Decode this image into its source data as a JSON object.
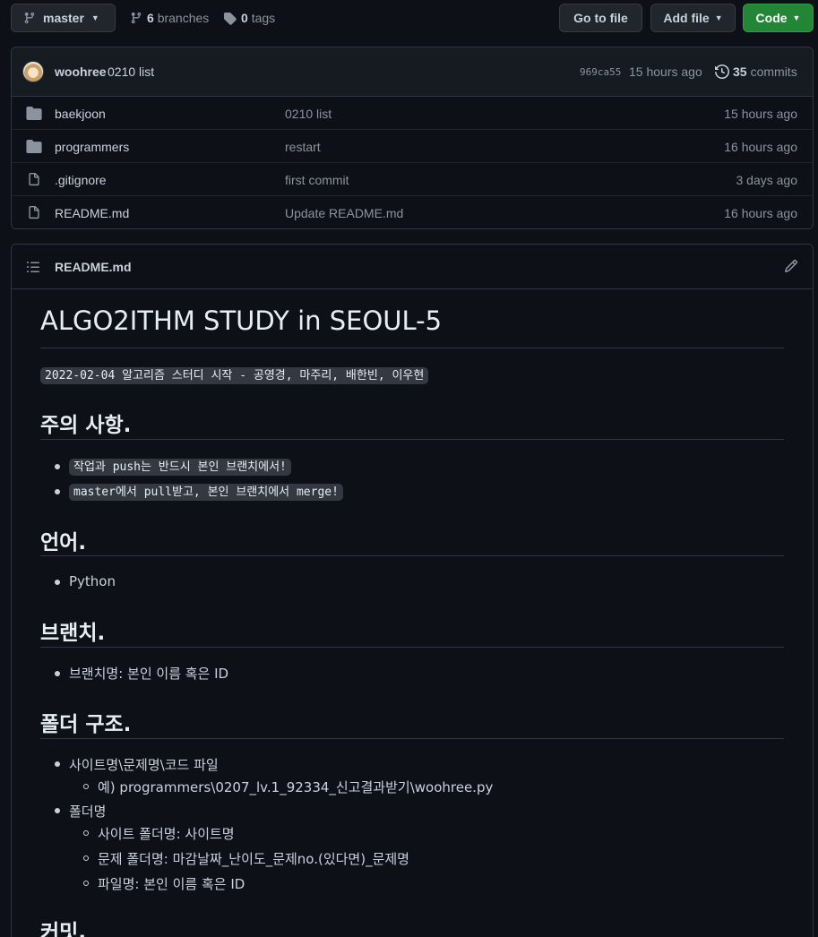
{
  "toolbar": {
    "branch_name": "master",
    "branches_count": "6",
    "branches_label": "branches",
    "tags_count": "0",
    "tags_label": "tags",
    "goto_file": "Go to file",
    "add_file": "Add file",
    "code": "Code"
  },
  "latest_commit": {
    "author": "woohree",
    "message": "0210 list",
    "hash": "969ca55",
    "time": "15 hours ago",
    "count": "35",
    "count_label": "commits"
  },
  "files": [
    {
      "type": "folder",
      "name": "baekjoon",
      "message": "0210 list",
      "time": "15 hours ago"
    },
    {
      "type": "folder",
      "name": "programmers",
      "message": "restart",
      "time": "16 hours ago"
    },
    {
      "type": "file",
      "name": ".gitignore",
      "message": "first commit",
      "time": "3 days ago"
    },
    {
      "type": "file",
      "name": "README.md",
      "message": "Update README.md",
      "time": "16 hours ago"
    }
  ],
  "readme": {
    "filename": "README.md",
    "title": "ALGO2ITHM STUDY in SEOUL-5",
    "intro_code": "2022-02-04 알고리즘 스터디 시작 - 공영경, 마주리, 배한빈, 이우현",
    "sections": {
      "notes": {
        "heading": "주의 사항.",
        "items": [
          "작업과 push는 반드시 본인 브랜치에서!",
          "master에서 pull받고, 본인 브랜치에서 merge!"
        ]
      },
      "language": {
        "heading": "언어.",
        "items": [
          "Python"
        ]
      },
      "branch": {
        "heading": "브랜치.",
        "items": [
          "브랜치명: 본인 이름 혹은 ID"
        ]
      },
      "folders": {
        "heading": "폴더 구조.",
        "item1": "사이트명\\문제명\\코드 파일",
        "item1_sub": "예) programmers\\0207_lv.1_92334_신고결과받기\\woohree.py",
        "item2": "폴더명",
        "item2_subs": [
          "사이트 폴더명: 사이트명",
          "문제 폴더명: 마감날짜_난이도_문제no.(있다면)_문제명",
          "파일명: 본인 이름 혹은 ID"
        ]
      },
      "commit": {
        "heading": "커밋."
      }
    }
  }
}
